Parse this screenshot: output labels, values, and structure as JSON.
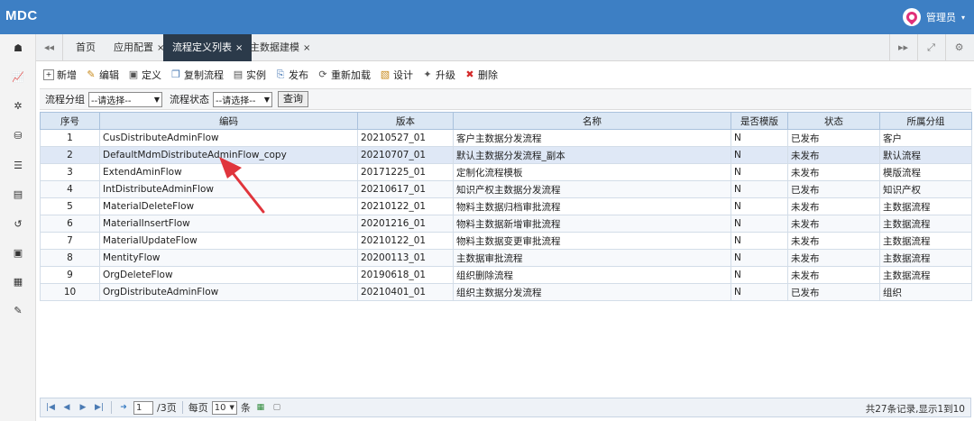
{
  "app": {
    "logo": "MDC"
  },
  "user": {
    "name": "管理员"
  },
  "colors": {
    "topbar": "#3d7fc4",
    "active_tab": "#2b3a4a",
    "header_row": "#dbe7f4",
    "arrow": "#e0353c"
  },
  "sidebar": {
    "items": [
      "home-icon",
      "chart-icon",
      "spinner-icon",
      "database-icon",
      "list-icon",
      "table-icon",
      "history-icon",
      "film-icon",
      "archive-icon",
      "wrench-icon"
    ]
  },
  "tabs": {
    "items": [
      {
        "label": "首页",
        "closable": false
      },
      {
        "label": "应用配置",
        "closable": true
      },
      {
        "label": "流程定义列表",
        "closable": true,
        "active": true
      },
      {
        "label": "主数据建模",
        "closable": true
      }
    ],
    "close_glyph": "×"
  },
  "toolbar": {
    "items": [
      {
        "label": "新增",
        "icon": "add-icon"
      },
      {
        "label": "编辑",
        "icon": "edit-icon"
      },
      {
        "label": "定义",
        "icon": "define-icon"
      },
      {
        "label": "复制流程",
        "icon": "copy-icon"
      },
      {
        "label": "实例",
        "icon": "instance-icon"
      },
      {
        "label": "发布",
        "icon": "publish-icon"
      },
      {
        "label": "重新加载",
        "icon": "reload-icon"
      },
      {
        "label": "设计",
        "icon": "design-icon"
      },
      {
        "label": "升级",
        "icon": "upgrade-icon"
      },
      {
        "label": "删除",
        "icon": "delete-icon"
      }
    ]
  },
  "filter": {
    "group_label": "流程分组",
    "group_value": "--请选择--",
    "status_label": "流程状态",
    "status_value": "--请选择--",
    "query_label": "查询"
  },
  "table": {
    "columns": [
      "序号",
      "编码",
      "版本",
      "名称",
      "是否模版",
      "状态",
      "所属分组"
    ],
    "rows": [
      [
        "1",
        "CusDistributeAdminFlow",
        "20210527_01",
        "客户主数据分发流程",
        "N",
        "已发布",
        "客户"
      ],
      [
        "2",
        "DefaultMdmDistributeAdminFlow_copy",
        "20210707_01",
        "默认主数据分发流程_副本",
        "N",
        "未发布",
        "默认流程"
      ],
      [
        "3",
        "ExtendAminFlow",
        "20171225_01",
        "定制化流程模板",
        "N",
        "未发布",
        "模版流程"
      ],
      [
        "4",
        "IntDistributeAdminFlow",
        "20210617_01",
        "知识产权主数据分发流程",
        "N",
        "已发布",
        "知识产权"
      ],
      [
        "5",
        "MaterialDeleteFlow",
        "20210122_01",
        "物料主数据归档审批流程",
        "N",
        "未发布",
        "主数据流程"
      ],
      [
        "6",
        "MaterialInsertFlow",
        "20201216_01",
        "物料主数据新增审批流程",
        "N",
        "未发布",
        "主数据流程"
      ],
      [
        "7",
        "MaterialUpdateFlow",
        "20210122_01",
        "物料主数据变更审批流程",
        "N",
        "未发布",
        "主数据流程"
      ],
      [
        "8",
        "MentityFlow",
        "20200113_01",
        "主数据审批流程",
        "N",
        "未发布",
        "主数据流程"
      ],
      [
        "9",
        "OrgDeleteFlow",
        "20190618_01",
        "组织删除流程",
        "N",
        "未发布",
        "主数据流程"
      ],
      [
        "10",
        "OrgDistributeAdminFlow",
        "20210401_01",
        "组织主数据分发流程",
        "N",
        "已发布",
        "组织"
      ]
    ]
  },
  "pager": {
    "page": "1",
    "total_pages": "/3页",
    "per_page_label": "每页",
    "per_page": "10",
    "per_page_unit": "条",
    "info": "共27条记录,显示1到10"
  }
}
